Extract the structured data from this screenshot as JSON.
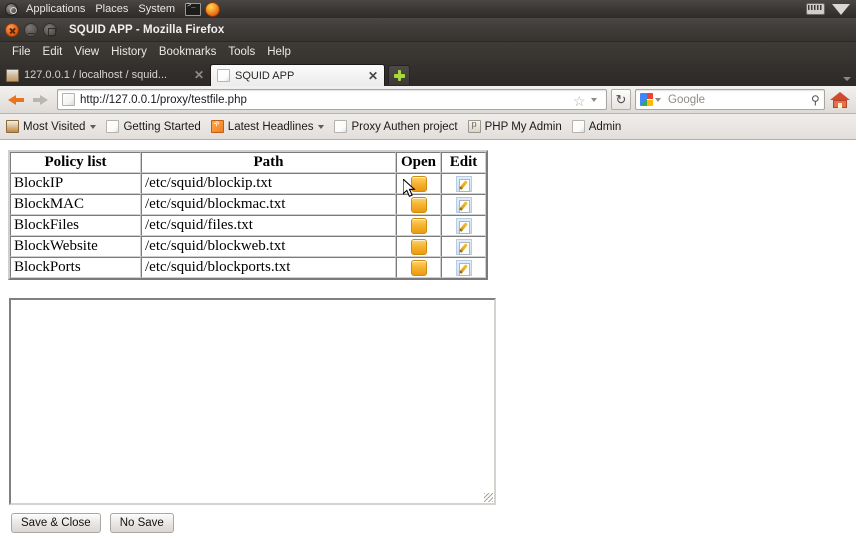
{
  "desktop_panel": {
    "menus": [
      "Applications",
      "Places",
      "System"
    ],
    "icons": [
      "ubuntu-logo-icon",
      "terminal-icon",
      "firefox-icon",
      "keyboard-indicator-icon",
      "volume-icon"
    ]
  },
  "window": {
    "title": "SQUID APP - Mozilla Firefox",
    "controls": [
      "close-icon",
      "minimize-icon",
      "maximize-icon"
    ]
  },
  "menubar": {
    "items": [
      "File",
      "Edit",
      "View",
      "History",
      "Bookmarks",
      "Tools",
      "Help"
    ]
  },
  "tabs": [
    {
      "label": "127.0.0.1 / localhost / squid...",
      "active": false,
      "favicon": "squid-favicon"
    },
    {
      "label": "SQUID APP",
      "active": true,
      "favicon": "page-favicon"
    }
  ],
  "newtab_label": "+",
  "navbar": {
    "back_icon": "back-arrow-icon",
    "forward_icon": "forward-arrow-icon",
    "url": "http://127.0.0.1/proxy/testfile.php",
    "star_glyph": "☆",
    "reload_glyph": "↻",
    "search_engine": "Google",
    "search_placeholder": "Google",
    "search_glyph": "⚲",
    "home_icon": "home-icon"
  },
  "bookmarks": [
    {
      "label": "Most Visited",
      "icon": "most-visited-icon",
      "has_caret": true
    },
    {
      "label": "Getting Started",
      "icon": "doc-icon",
      "has_caret": false
    },
    {
      "label": "Latest Headlines",
      "icon": "rss-icon",
      "has_caret": true
    },
    {
      "label": "Proxy Authen project",
      "icon": "doc-icon",
      "has_caret": false
    },
    {
      "label": "PHP My Admin",
      "icon": "php-icon",
      "has_caret": false
    },
    {
      "label": "Admin",
      "icon": "doc-icon",
      "has_caret": false
    }
  ],
  "page": {
    "table": {
      "headers": [
        "Policy list",
        "Path",
        "Open",
        "Edit"
      ],
      "rows": [
        {
          "policy": "BlockIP",
          "path": "/etc/squid/blockip.txt",
          "open_icon": "folder-open-icon",
          "edit_icon": "pencil-edit-icon"
        },
        {
          "policy": "BlockMAC",
          "path": "/etc/squid/blockmac.txt",
          "open_icon": "folder-open-icon",
          "edit_icon": "pencil-edit-icon"
        },
        {
          "policy": "BlockFiles",
          "path": "/etc/squid/files.txt",
          "open_icon": "folder-open-icon",
          "edit_icon": "pencil-edit-icon"
        },
        {
          "policy": "BlockWebsite",
          "path": "/etc/squid/blockweb.txt",
          "open_icon": "folder-open-icon",
          "edit_icon": "pencil-edit-icon"
        },
        {
          "policy": "BlockPorts",
          "path": "/etc/squid/blockports.txt",
          "open_icon": "folder-open-icon",
          "edit_icon": "pencil-edit-icon"
        }
      ]
    },
    "editor": {
      "value": "",
      "placeholder": ""
    },
    "buttons": {
      "save_close": "Save & Close",
      "no_save": "No Save"
    }
  },
  "colors": {
    "accent_orange": "#e8741d",
    "panel_dark": "#3b3836",
    "folder_icon": "#f7b430",
    "edit_icon": "#cfe0f2"
  }
}
